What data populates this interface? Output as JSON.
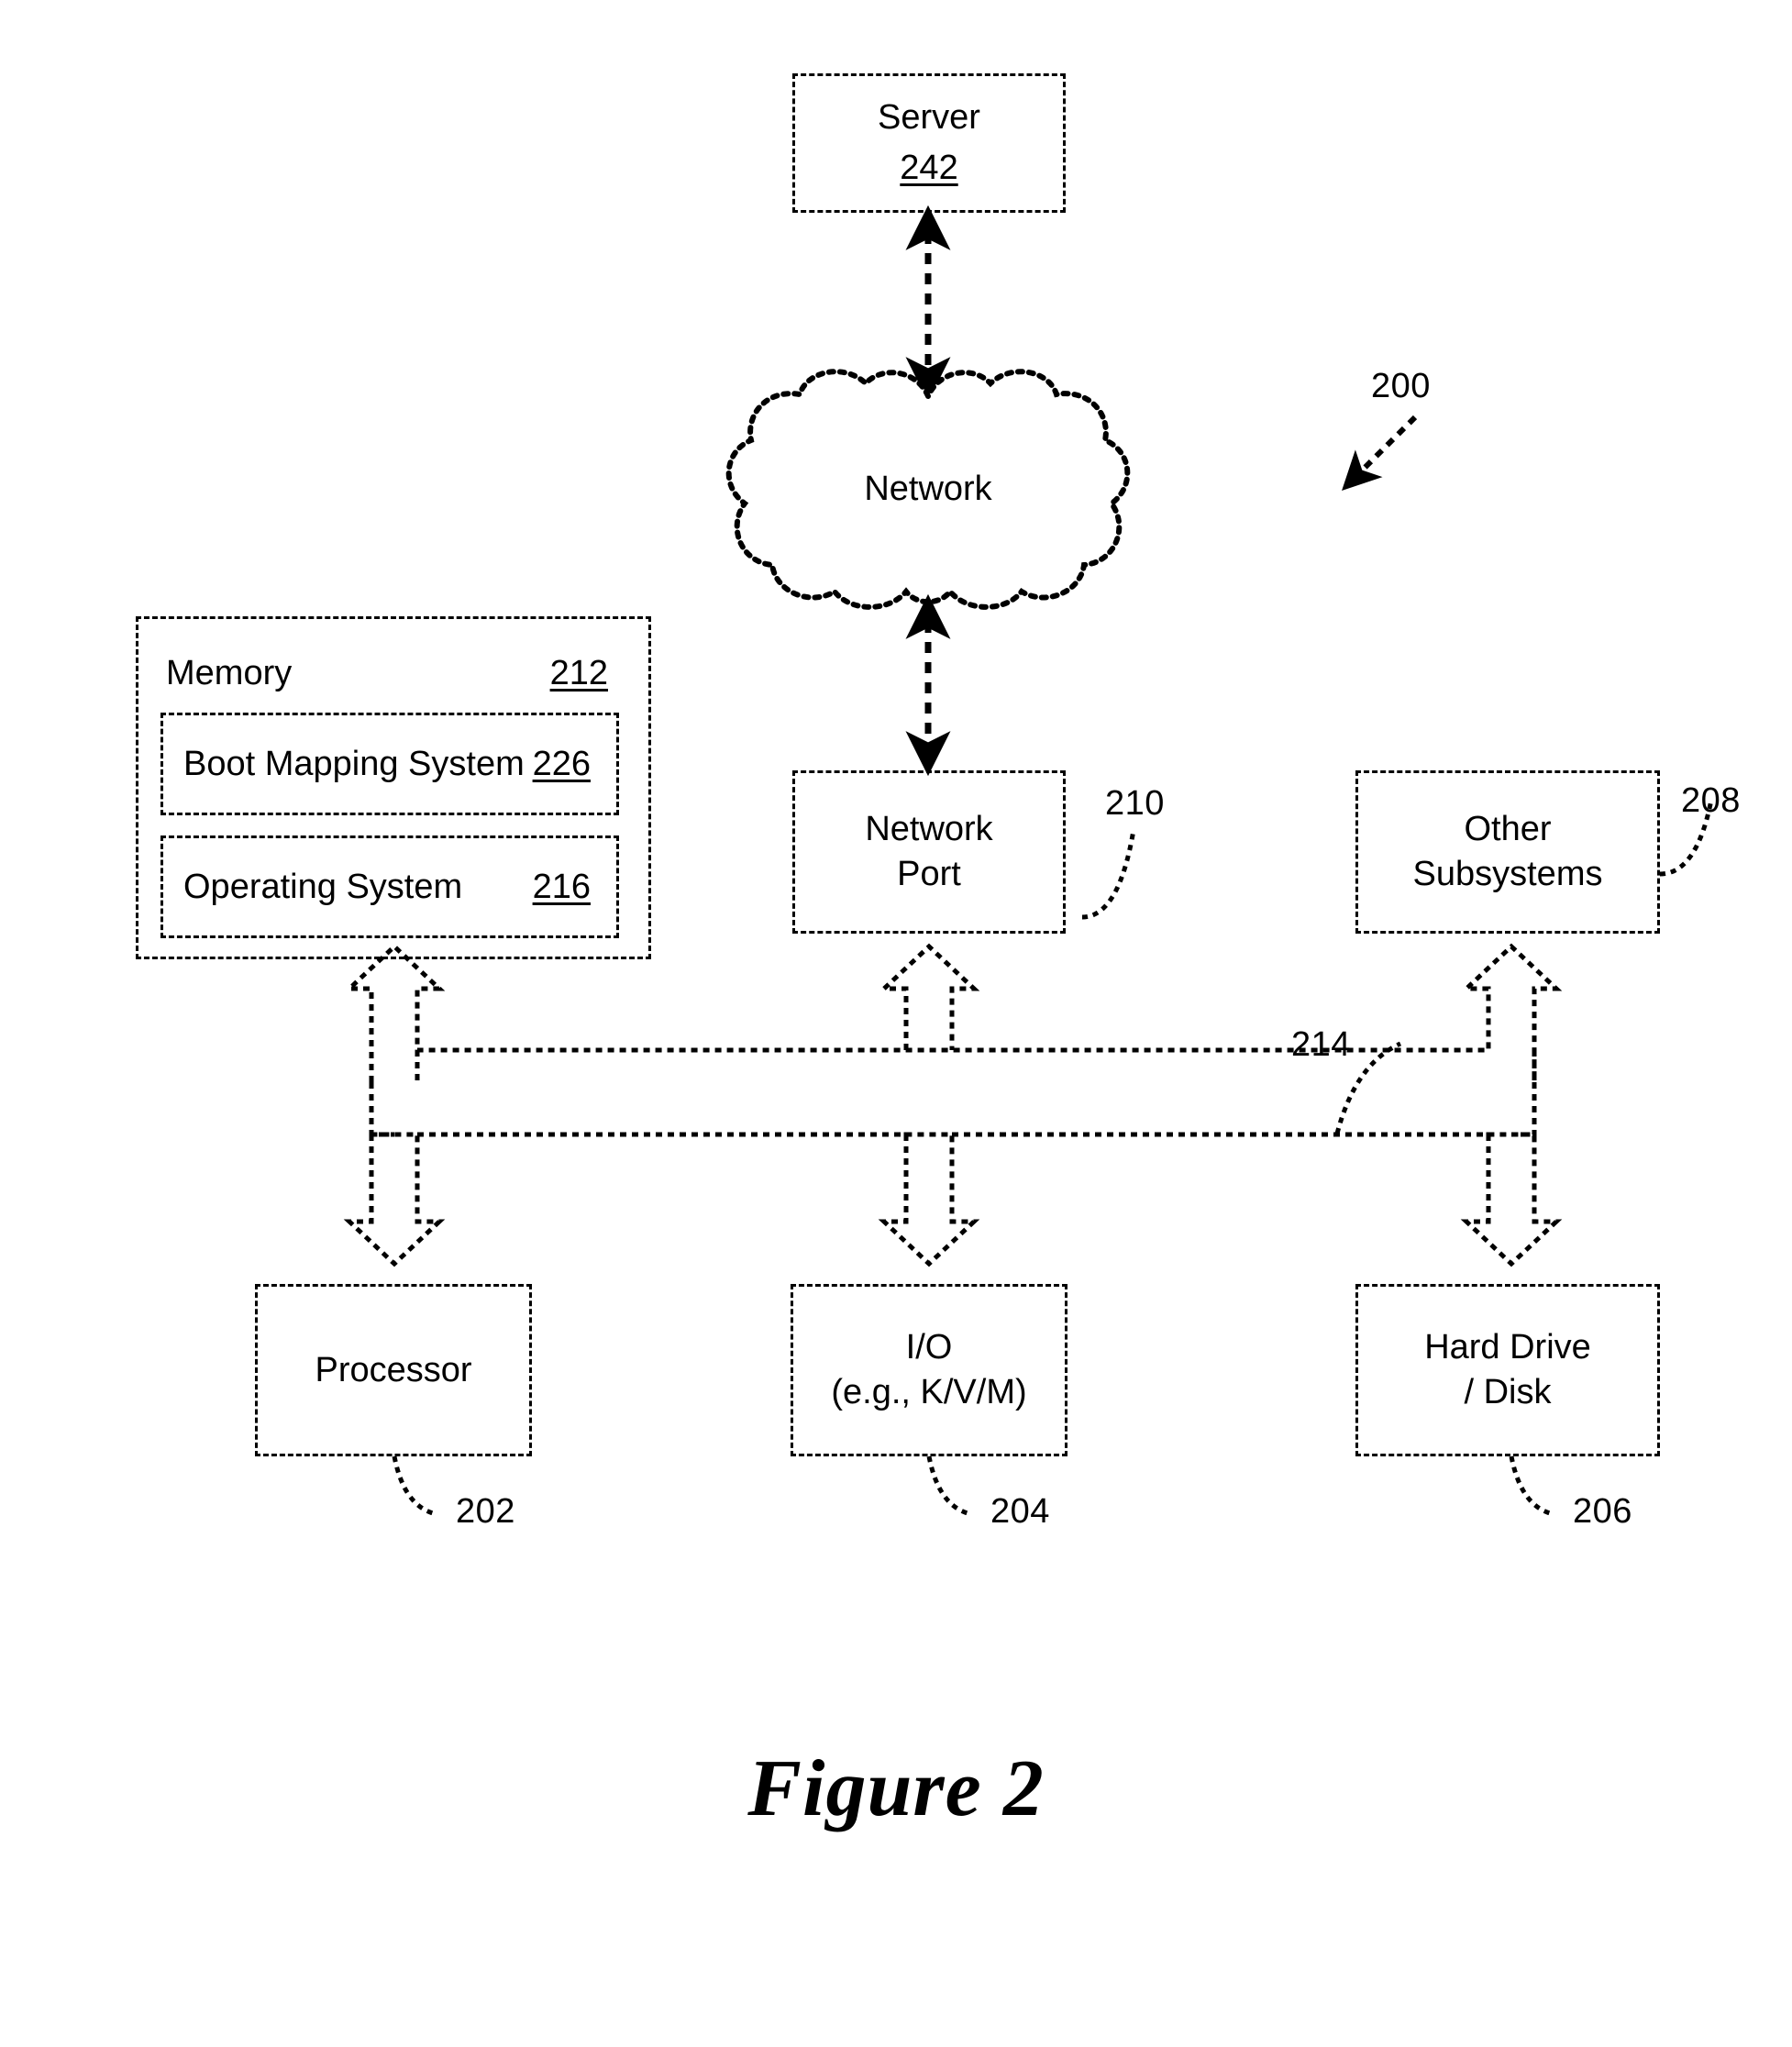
{
  "figure": {
    "caption": "Figure 2",
    "system_ref": "200"
  },
  "nodes": {
    "server": {
      "label": "Server",
      "ref": "242",
      "ref_style": "inline-underlined"
    },
    "network_cloud": {
      "label": "Network",
      "ref": "",
      "ref_style": "none"
    },
    "network_port": {
      "label": "Network\nPort",
      "ref": "210",
      "ref_style": "leader-right"
    },
    "other_subsystems": {
      "label": "Other\nSubsystems",
      "ref": "208",
      "ref_style": "leader-right"
    },
    "processor": {
      "label": "Processor",
      "ref": "202",
      "ref_style": "leader-bottom"
    },
    "io": {
      "label": "I/O\n(e.g., K/V/M)",
      "ref": "204",
      "ref_style": "leader-bottom"
    },
    "hard_drive": {
      "label": "Hard Drive\n/ Disk",
      "ref": "206",
      "ref_style": "leader-bottom"
    },
    "bus": {
      "label": "",
      "ref": "214",
      "ref_style": "leader-left"
    }
  },
  "memory": {
    "title": "Memory",
    "ref": "212",
    "components": [
      {
        "name": "Boot Mapping System",
        "ref": "226"
      },
      {
        "name": "Operating System",
        "ref": "216"
      }
    ]
  },
  "connections": [
    {
      "from": "server",
      "to": "network_cloud",
      "style": "dashed-double-arrow"
    },
    {
      "from": "network_cloud",
      "to": "network_port",
      "style": "dashed-double-arrow"
    },
    {
      "from": "memory",
      "to": "bus",
      "style": "block-double-arrow"
    },
    {
      "from": "network_port",
      "to": "bus",
      "style": "block-double-arrow"
    },
    {
      "from": "other_subsystems",
      "to": "bus",
      "style": "block-double-arrow"
    },
    {
      "from": "bus",
      "to": "processor",
      "style": "block-double-arrow"
    },
    {
      "from": "bus",
      "to": "io",
      "style": "block-double-arrow"
    },
    {
      "from": "bus",
      "to": "hard_drive",
      "style": "block-double-arrow"
    }
  ],
  "colors": {
    "ink": "#000000",
    "background": "#ffffff"
  }
}
